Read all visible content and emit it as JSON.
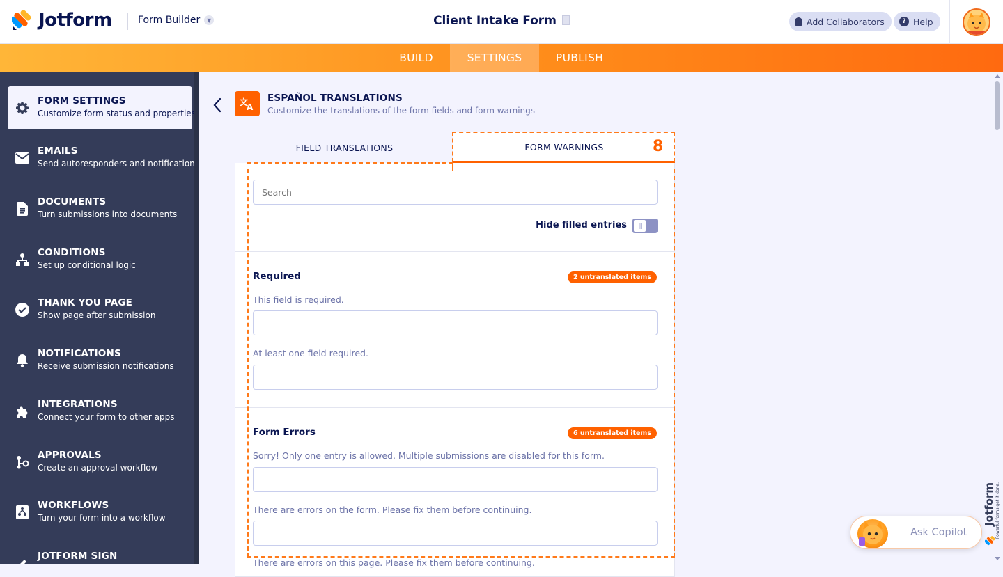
{
  "header": {
    "logo_text": "Jotform",
    "builder_dropdown": "Form Builder",
    "form_title": "Client Intake Form",
    "add_collaborators": "Add Collaborators",
    "help": "Help"
  },
  "nav": {
    "tabs": [
      {
        "label": "BUILD",
        "active": false
      },
      {
        "label": "SETTINGS",
        "active": true
      },
      {
        "label": "PUBLISH",
        "active": false
      }
    ]
  },
  "sidebar": {
    "items": [
      {
        "title": "FORM SETTINGS",
        "subtitle": "Customize form status and properties",
        "icon": "gear-icon",
        "active": true
      },
      {
        "title": "EMAILS",
        "subtitle": "Send autoresponders and notifications",
        "icon": "envelope-icon",
        "active": false
      },
      {
        "title": "DOCUMENTS",
        "subtitle": "Turn submissions into documents",
        "icon": "document-icon",
        "active": false
      },
      {
        "title": "CONDITIONS",
        "subtitle": "Set up conditional logic",
        "icon": "conditions-icon",
        "active": false
      },
      {
        "title": "THANK YOU PAGE",
        "subtitle": "Show page after submission",
        "icon": "check-circle-icon",
        "active": false
      },
      {
        "title": "NOTIFICATIONS",
        "subtitle": "Receive submission notifications",
        "icon": "bell-icon",
        "active": false
      },
      {
        "title": "INTEGRATIONS",
        "subtitle": "Connect your form to other apps",
        "icon": "puzzle-icon",
        "active": false
      },
      {
        "title": "APPROVALS",
        "subtitle": "Create an approval workflow",
        "icon": "approval-icon",
        "active": false
      },
      {
        "title": "WORKFLOWS",
        "subtitle": "Turn your form into a workflow",
        "icon": "workflow-icon",
        "active": false
      },
      {
        "title": "JOTFORM SIGN",
        "subtitle": "",
        "icon": "sign-icon",
        "active": false
      }
    ]
  },
  "translations": {
    "title": "ESPAÑOL TRANSLATIONS",
    "subtitle": "Customize the translations of the form fields and form warnings",
    "tabs": {
      "field": "FIELD TRANSLATIONS",
      "warnings": "FORM WARNINGS"
    },
    "step_badge": "8",
    "search_placeholder": "Search",
    "hide_filled_label": "Hide filled entries",
    "hide_filled_on": false,
    "sections": [
      {
        "title": "Required",
        "badge": "2 untranslated items",
        "fields": [
          {
            "label": "This field is required.",
            "value": ""
          },
          {
            "label": "At least one field required.",
            "value": ""
          }
        ]
      },
      {
        "title": "Form Errors",
        "badge": "6 untranslated items",
        "fields": [
          {
            "label": "Sorry! Only one entry is allowed. Multiple submissions are disabled for this form.",
            "value": ""
          },
          {
            "label": "There are errors on the form. Please fix them before continuing.",
            "value": ""
          },
          {
            "label": "There are errors on this page. Please fix them before continuing.",
            "value": ""
          }
        ]
      }
    ]
  },
  "copilot": {
    "label": "Ask Copilot"
  },
  "brand_side": {
    "name": "Jotform",
    "tagline": "Powerful forms get it done."
  },
  "colors": {
    "accent": "#ff6100",
    "navy": "#0a1551",
    "sidebar_bg": "#343c59",
    "nav_gradient_start": "#ffb638",
    "nav_gradient_end": "#ff6a10"
  }
}
